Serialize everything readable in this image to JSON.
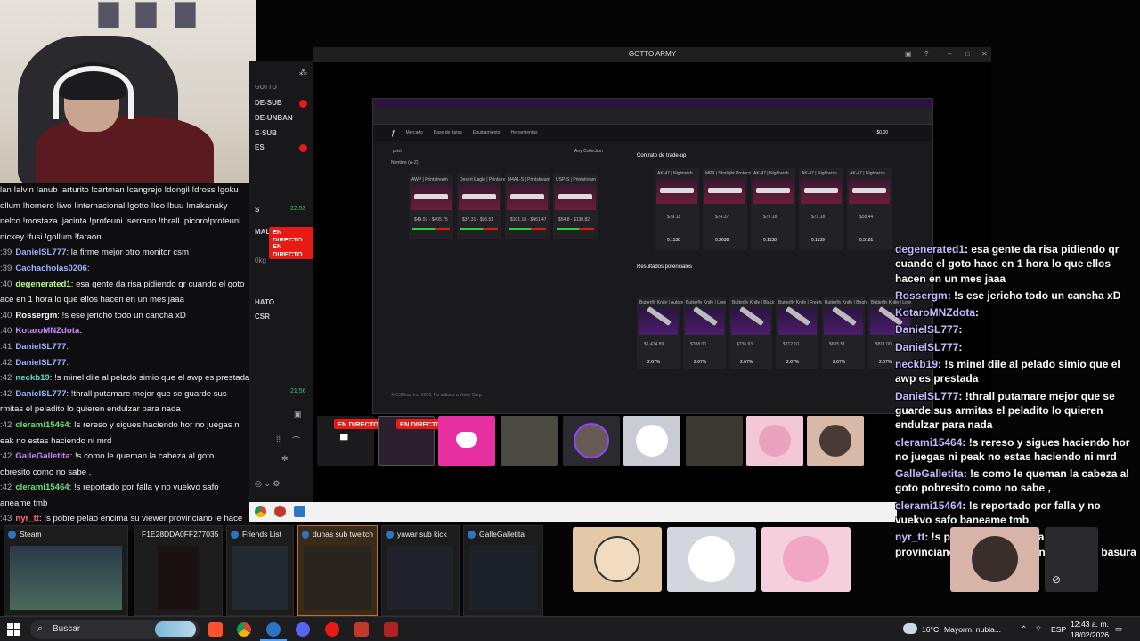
{
  "window": {
    "title": "GOTTO ARMY"
  },
  "manager": {
    "items": [
      "GOTTO",
      "DE-SUB",
      "DE-UNBAN",
      "E-SUB",
      "ES"
    ],
    "live_label": "EN DIRECTO",
    "sidebar_labels": [
      "S",
      "MAL",
      "0kg",
      "HATO",
      "CSR"
    ],
    "time_top": "22:53",
    "time_bottom": "21:56"
  },
  "left_chat": [
    {
      "text": "lan !alvin !anub !arturito !cartman !cangrejo !dongil !dross !goku"
    },
    {
      "text": "ollum !homero !iwo !internacional !gotto !leo !buu !makanaky"
    },
    {
      "text": "nelco !mostaza !jacinta !profeuni !serrano !thrall !picoro!profeuni"
    },
    {
      "text": "nickey !fusi !gollum !faraon"
    },
    {
      "prefix": ":39",
      "user": "DanielSL777",
      "msg": ": la firme mejor otro monitor csm",
      "color": "#9ab4ff"
    },
    {
      "prefix": ":39",
      "user": "Cachacholas0206",
      "msg": ":",
      "color": "#9ab4ff"
    },
    {
      "prefix": ":40",
      "user": "degenerated1",
      "msg": ": esa gente da risa pidiendo qr cuando el goto",
      "color": "#b7ff8a"
    },
    {
      "text": "ace en 1 hora lo que ellos hacen en un mes jaaa"
    },
    {
      "prefix": ":40",
      "user": "Rossergm",
      "msg": ": !s ese jericho todo un cancha xD",
      "color": "#ffffff"
    },
    {
      "prefix": ":40",
      "user": "KotaroMNZdota",
      "msg": ":",
      "color": "#c78bff"
    },
    {
      "prefix": ":41",
      "user": "DanielSL777",
      "msg": ":",
      "color": "#9ab4ff"
    },
    {
      "prefix": ":42",
      "user": "DanielSL777",
      "msg": ":",
      "color": "#9ab4ff"
    },
    {
      "prefix": ":42",
      "user": "neckb19",
      "msg": ": !s minel dile al pelado simio que el awp es prestada",
      "color": "#5fd9c8"
    },
    {
      "prefix": ":42",
      "user": "DanielSL777",
      "msg": ": !thrall putamare mejor que se guarde sus",
      "color": "#9ab4ff"
    },
    {
      "text": "rmitas el peladito lo quieren endulzar para nada"
    },
    {
      "prefix": ":42",
      "user": "clerami15464",
      "msg": ": !s rereso y sigues haciendo hor no juegas ni",
      "color": "#6de07a"
    },
    {
      "text": "eak no estas haciendo ni mrd"
    },
    {
      "prefix": ":42",
      "user": "GalleGalletita",
      "msg": ": !s como le queman la cabeza al goto",
      "color": "#c78bff"
    },
    {
      "text": "obresito como no sabe ,"
    },
    {
      "prefix": ":42",
      "user": "clerami15464",
      "msg": ": !s reportado por falla y no vuekvo safo",
      "color": "#6de07a"
    },
    {
      "text": "aneame tmb"
    },
    {
      "prefix": ":43",
      "user": "nyr_tt",
      "msg": ": !s pobre pelao encima su viewer provinciano le hace",
      "color": "#ff6e6e"
    }
  ],
  "site": {
    "nav": [
      "Mercado",
      "Base de datos",
      "Equipamiento",
      "Herramientas"
    ],
    "balance": "$0.00",
    "contract_title": "Contrato de trade-up",
    "results_title": "Resultados potenciales",
    "search_placeholder": "print",
    "sort": "Nombre (A-Z)",
    "collection": "Any Collection",
    "skins": [
      {
        "name": "AWP | Printstream",
        "price": "$49.97 - $405.75"
      },
      {
        "name": "Desert Eagle | Printstream",
        "price": "$37.31 - $96.51"
      },
      {
        "name": "M4A1-S | Printstream",
        "price": "$101.18 - $461.47"
      },
      {
        "name": "USP-S | Printstream",
        "price": "$54.8 - $130.82"
      }
    ],
    "inputs": [
      {
        "name": "AK-47 | Nightwish",
        "price": "$79.18",
        "float": "0.1138"
      },
      {
        "name": "MP9 | Starlight Protector",
        "price": "$74.37",
        "float": "0.2638"
      },
      {
        "name": "AK-47 | Nightwish",
        "price": "$79.18",
        "float": "0.1138"
      },
      {
        "name": "AK-47 | Nightwish",
        "price": "$79.18",
        "float": "0.1139"
      },
      {
        "name": "AK-47 | Nightwish",
        "price": "$58.44",
        "float": "0.3181"
      }
    ],
    "knives": [
      {
        "name": "Butterfly Knife | Autotronic",
        "price": "$1,414.89",
        "pct": "2.67%"
      },
      {
        "name": "Butterfly Knife | Lore",
        "price": "$708.00",
        "pct": "2.67%"
      },
      {
        "name": "Butterfly Knife | Black Laminate",
        "price": "$736.93",
        "pct": "2.67%"
      },
      {
        "name": "Butterfly Knife | Freehand",
        "price": "$712.10",
        "pct": "2.67%"
      },
      {
        "name": "Butterfly Knife | Bright Water",
        "price": "$635.51",
        "pct": "2.67%"
      },
      {
        "name": "Butterfly Knife | Lore",
        "price": "$811.00",
        "pct": "2.67%"
      }
    ],
    "footer": "© CSFloat Inc. 2026. No afiliado a Valve Corp."
  },
  "right_chat": [
    {
      "user": "degenerated1",
      "msg": ": esa gente da risa pidiendo qr cuando el goto hace en 1 hora lo que ellos hacen en un mes jaaa"
    },
    {
      "user": "Rossergm",
      "msg": ": !s ese jericho todo un cancha xD"
    },
    {
      "user": "KotaroMNZdota",
      "msg": ":"
    },
    {
      "user": "DanielSL777",
      "msg": ":"
    },
    {
      "user": "DanielSL777",
      "msg": ":"
    },
    {
      "user": "neckb19",
      "msg": ": !s minel dile al pelado simio que el awp es prestada"
    },
    {
      "user": "DanielSL777",
      "msg": ": !thrall putamare mejor que se guarde sus armitas el peladito lo quieren endulzar para nada"
    },
    {
      "user": "clerami15464",
      "msg": ": !s rereso y sigues haciendo hor no juegas ni peak no estas haciendo ni mrd"
    },
    {
      "user": "GalleGalletita",
      "msg": ": !s como le queman la cabeza al goto pobresito como no sabe ,"
    },
    {
      "user": "clerami15464",
      "msg": ": !s reportado por falla y no vuekvo safo baneame tmb"
    },
    {
      "user": "nyr_tt",
      "msg": ": !s pobre pelao encima su viewer provinciano le hace gastar en 3 rosadas basura"
    }
  ],
  "alt_tab": [
    {
      "label": "Steam"
    },
    {
      "label": "F1E28DDA0FF277035..."
    },
    {
      "label": "Friends List"
    },
    {
      "label": "dunas sub tweitch"
    },
    {
      "label": "yawar sub kick"
    },
    {
      "label": "GalleGalletita"
    }
  ],
  "taskbar": {
    "search": "Buscar",
    "weather": "16°C",
    "weather_desc": "Mayorm. nubla...",
    "lang": "ESP",
    "time": "12:43 a. m.",
    "date": "18/02/2026"
  },
  "colors": {
    "live": "#e91916",
    "twitch_purple": "#9146ff",
    "discord": "#e62fa0"
  }
}
